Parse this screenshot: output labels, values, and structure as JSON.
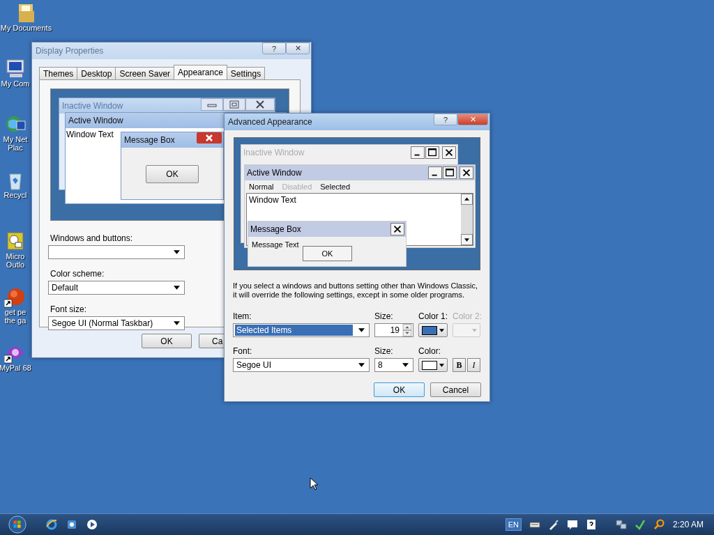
{
  "desktop_icons": [
    {
      "label": "My Documents",
      "kind": "folder"
    },
    {
      "label": "My Com",
      "kind": "computer"
    },
    {
      "label": "My Net\nPlac",
      "kind": "network"
    },
    {
      "label": "Recycl",
      "kind": "bin"
    },
    {
      "label": "Micro\nOutlo",
      "kind": "outlook"
    },
    {
      "label": "get pe\nthe ga",
      "kind": "ball",
      "shortcut": true
    },
    {
      "label": "MyPal 68",
      "kind": "browser",
      "shortcut": true
    }
  ],
  "display_properties": {
    "title": "Display Properties",
    "help": "?",
    "close": "✕",
    "tabs": [
      {
        "label": "Themes",
        "selected": false
      },
      {
        "label": "Desktop",
        "selected": false
      },
      {
        "label": "Screen Saver",
        "selected": false
      },
      {
        "label": "Appearance",
        "selected": true
      },
      {
        "label": "Settings",
        "selected": false
      }
    ],
    "preview": {
      "inactive_title": "Inactive Window",
      "active_title": "Active Window",
      "window_text": "Window Text",
      "message_title": "Message Box",
      "ok": "OK"
    },
    "fields": [
      {
        "label": "Windows and buttons:"
      },
      {
        "label": "Color scheme:",
        "value": "Default"
      },
      {
        "label": "Font size:",
        "value": "Segoe UI (Normal Taskbar)"
      }
    ],
    "buttons": [
      "OK",
      "Ca"
    ]
  },
  "advanced": {
    "title": "Advanced Appearance",
    "help": "?",
    "close": "✕",
    "preview": {
      "inactive_title": "Inactive Window",
      "active_title": "Active Window",
      "menu": [
        {
          "label": "Normal",
          "kind": "normal"
        },
        {
          "label": "Disabled",
          "kind": "disabled"
        },
        {
          "label": "Selected",
          "kind": "selected"
        }
      ],
      "window_text": "Window Text",
      "message_title": "Message Box",
      "message_text": "Message Text",
      "ok": "OK"
    },
    "note": "If you select a windows and buttons setting other than Windows Classic, it will override the following settings, except in some older programs.",
    "item": {
      "label": "Item:",
      "value": "Selected Items"
    },
    "item_size": {
      "label": "Size:",
      "value": "19"
    },
    "color1": {
      "label": "Color 1:",
      "color": "#3a6fb5",
      "disabled": false
    },
    "color2": {
      "label": "Color 2:",
      "disabled": true
    },
    "font": {
      "label": "Font:",
      "value": "Segoe UI"
    },
    "font_size": {
      "label": "Size:",
      "value": "8"
    },
    "font_color": {
      "label": "Color:",
      "color": "#ffffff",
      "disabled": false
    },
    "style_buttons": [
      {
        "label": "B",
        "kind": "bold"
      },
      {
        "label": "I",
        "kind": "italic"
      }
    ],
    "buttons": [
      "OK",
      "Cancel"
    ]
  },
  "taskbar": {
    "language": "EN",
    "clock": "2:20 AM"
  }
}
